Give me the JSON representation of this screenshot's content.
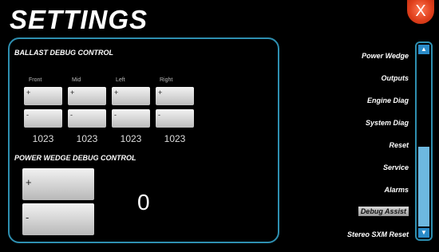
{
  "title": "SETTINGS",
  "close_label": "X",
  "ballast": {
    "title": "BALLAST DEBUG CONTROL",
    "columns": [
      {
        "label": "Front",
        "plus": "+",
        "minus": "-",
        "value": "1023"
      },
      {
        "label": "Mid",
        "plus": "+",
        "minus": "-",
        "value": "1023"
      },
      {
        "label": "Left",
        "plus": "+",
        "minus": "-",
        "value": "1023"
      },
      {
        "label": "Right",
        "plus": "+",
        "minus": "-",
        "value": "1023"
      }
    ]
  },
  "power_wedge": {
    "title": "POWER WEDGE DEBUG CONTROL",
    "plus": "+",
    "minus": "-",
    "value": "0"
  },
  "menu": {
    "items": [
      {
        "label": "Power Wedge"
      },
      {
        "label": "Outputs"
      },
      {
        "label": "Engine Diag"
      },
      {
        "label": "System Diag"
      },
      {
        "label": "Reset"
      },
      {
        "label": "Service"
      },
      {
        "label": "Alarms"
      },
      {
        "label": "Debug Assist",
        "selected": true
      },
      {
        "label": "Stereo SXM Reset"
      }
    ]
  },
  "scrollbar": {
    "up": "▲",
    "down": "▼",
    "position": 0.6
  },
  "colors": {
    "accent": "#2e8fb0",
    "close": "#e0401c",
    "thumb": "#6db8e0"
  }
}
